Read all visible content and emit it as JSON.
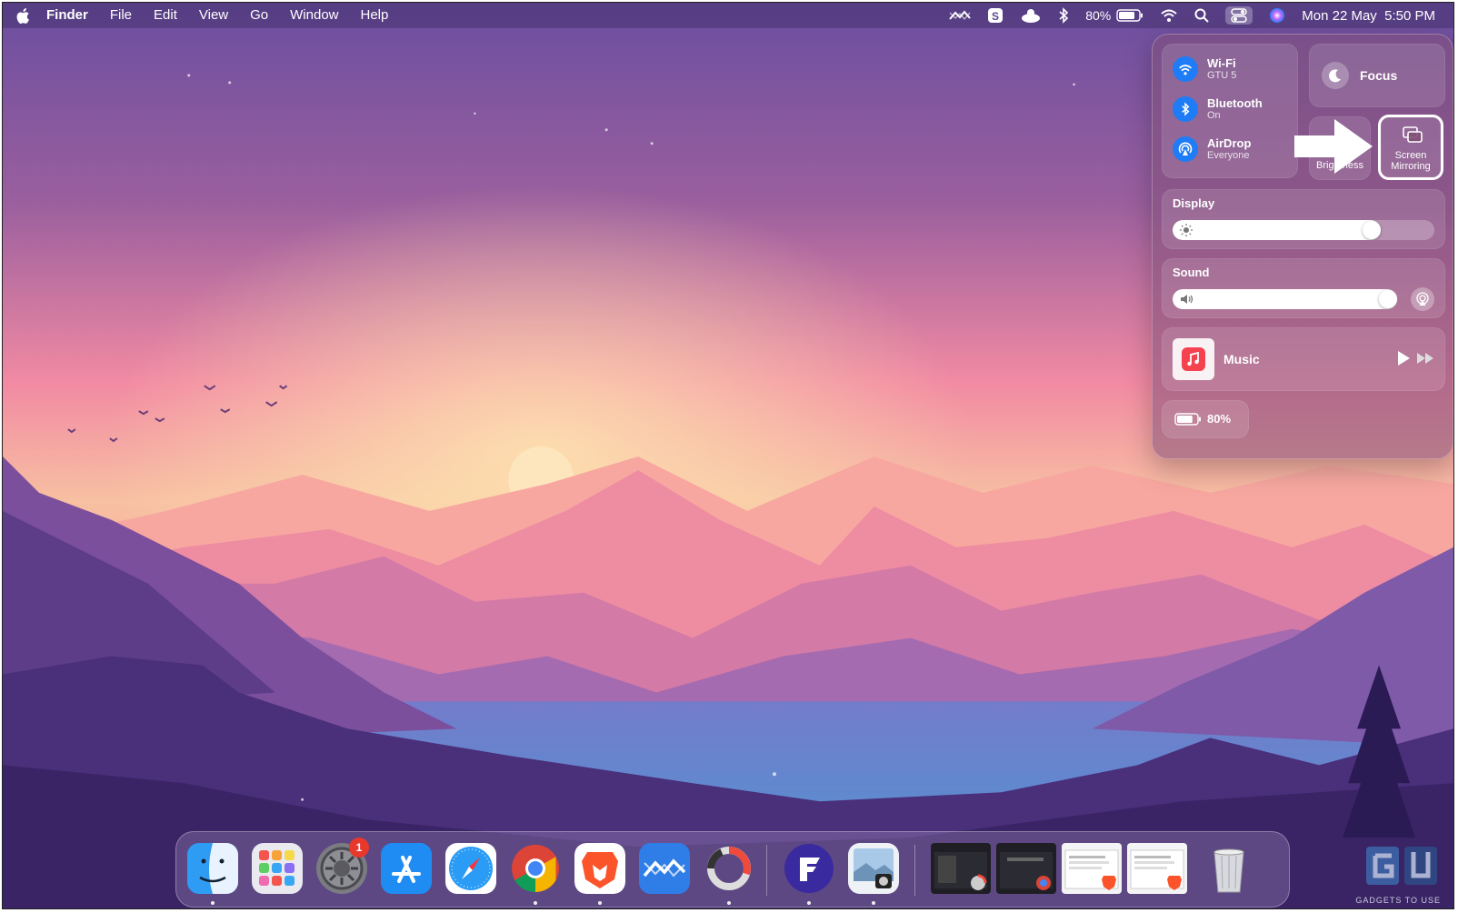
{
  "menubar": {
    "app_name": "Finder",
    "menus": [
      "File",
      "Edit",
      "View",
      "Go",
      "Window",
      "Help"
    ],
    "battery_percent": "80%",
    "datetime": "Mon 22 May  5:50 PM"
  },
  "control_center": {
    "wifi": {
      "title": "Wi-Fi",
      "subtitle": "GTU 5"
    },
    "bluetooth": {
      "title": "Bluetooth",
      "subtitle": "On"
    },
    "airdrop": {
      "title": "AirDrop",
      "subtitle": "Everyone"
    },
    "focus_label": "Focus",
    "brightness_label": "Brightness",
    "screen_mirroring": {
      "line1": "Screen",
      "line2": "Mirroring"
    },
    "display": {
      "title": "Display",
      "level": 0.78
    },
    "sound": {
      "title": "Sound",
      "level": 1.0
    },
    "music_label": "Music",
    "battery": {
      "label": "80%",
      "level": 0.8
    }
  },
  "dock": {
    "apps": [
      "Finder",
      "Launchpad",
      "System Settings",
      "App Store",
      "Safari",
      "Google Chrome",
      "Brave Browser",
      "Stocks",
      "Loading",
      "Fenix",
      "Preview"
    ],
    "settings_badge": "1",
    "minimized_windows": 4
  },
  "colors": {
    "accent_blue": "#1e7cf7",
    "badge_red": "#e8372b"
  },
  "watermark_text": "GADGETS TO USE"
}
